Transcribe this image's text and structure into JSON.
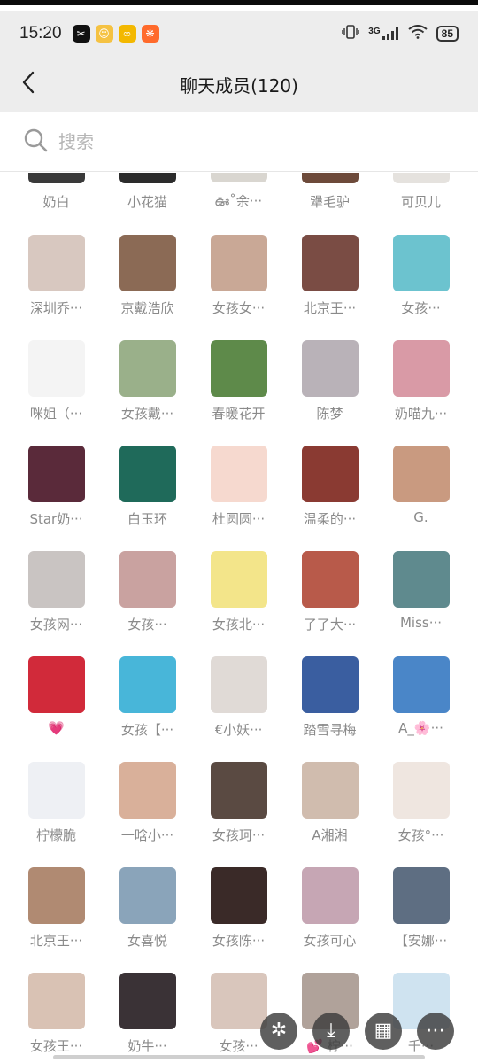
{
  "status_bar": {
    "time": "15:20",
    "network": "3G",
    "battery": "85",
    "notification_icons": [
      {
        "name": "capcut-icon",
        "color": "#111111",
        "glyph": "✂"
      },
      {
        "name": "emoji-icon",
        "color": "#f5c242",
        "glyph": "☺"
      },
      {
        "name": "glasses-icon",
        "color": "#f3b800",
        "glyph": "∞"
      },
      {
        "name": "orange-app-icon",
        "color": "#ff6a2b",
        "glyph": "❋"
      }
    ]
  },
  "nav": {
    "title": "聊天成员(120)"
  },
  "search": {
    "placeholder": "搜索"
  },
  "partial_row": {
    "members": [
      {
        "name": "奶白",
        "color": "#3a3a3a"
      },
      {
        "name": "小花猫",
        "color": "#2c2c2c"
      },
      {
        "name": "ఊ˚余···",
        "color": "#d9d6d0"
      },
      {
        "name": "犟毛驴",
        "color": "#6d4a3a"
      },
      {
        "name": "可贝儿",
        "color": "#e5e2de"
      }
    ]
  },
  "rows": [
    [
      {
        "name": "深圳乔···",
        "color": "#d8c8c0"
      },
      {
        "name": "京戴浩欣",
        "color": "#8b6a55"
      },
      {
        "name": "女孩女···",
        "color": "#c9a896"
      },
      {
        "name": "北京王···",
        "color": "#7a4c44"
      },
      {
        "name": "女孩···",
        "color": "#6cc3cf"
      }
    ],
    [
      {
        "name": "咪姐（···",
        "color": "#f4f4f4"
      },
      {
        "name": "女孩戴···",
        "color": "#9ab08a"
      },
      {
        "name": "春暖花开",
        "color": "#5e8a4a"
      },
      {
        "name": "陈梦",
        "color": "#b9b2b8"
      },
      {
        "name": "奶喵九···",
        "color": "#d99aa6"
      }
    ],
    [
      {
        "name": "Star奶···",
        "color": "#5a2a3a"
      },
      {
        "name": "白玉环",
        "color": "#1f6a5a"
      },
      {
        "name": "杜圆圆···",
        "color": "#f6d9cf"
      },
      {
        "name": "温柔的···",
        "color": "#8a3a32"
      },
      {
        "name": "G.",
        "color": "#c99a80"
      }
    ],
    [
      {
        "name": "女孩网···",
        "color": "#c9c4c2"
      },
      {
        "name": "女孩···",
        "color": "#c9a2a0"
      },
      {
        "name": "女孩北···",
        "color": "#f3e58a"
      },
      {
        "name": "了了大···",
        "color": "#b85a4a"
      },
      {
        "name": "Miss···",
        "color": "#5f8a8e"
      }
    ],
    [
      {
        "name": "💗",
        "color": "#d12a3a"
      },
      {
        "name": "女孩【···",
        "color": "#48b6d9"
      },
      {
        "name": "€小妖···",
        "color": "#e0dad6"
      },
      {
        "name": "踏雪寻梅",
        "color": "#3a5ea0"
      },
      {
        "name": "A_🌸···",
        "color": "#4a86c8"
      }
    ],
    [
      {
        "name": "柠檬脆",
        "color": "#eef0f4"
      },
      {
        "name": "一晗小···",
        "color": "#d9b09a"
      },
      {
        "name": "女孩珂···",
        "color": "#5a4a42"
      },
      {
        "name": "A湘湘",
        "color": "#d0bcae"
      },
      {
        "name": "女孩°···",
        "color": "#efe6e0"
      }
    ],
    [
      {
        "name": "北京王···",
        "color": "#b08a72"
      },
      {
        "name": "女喜悦",
        "color": "#8aa4ba"
      },
      {
        "name": "女孩陈···",
        "color": "#3a2a28"
      },
      {
        "name": "女孩可心",
        "color": "#c6a6b4"
      },
      {
        "name": "【安娜···",
        "color": "#5e6e82"
      }
    ],
    [
      {
        "name": "女孩王···",
        "color": "#d9c2b4"
      },
      {
        "name": "奶牛···",
        "color": "#3a3236"
      },
      {
        "name": "女孩···",
        "color": "#d9c6bc"
      },
      {
        "name": "💕 柠···",
        "color": "#b0a29a"
      },
      {
        "name": "千···",
        "color": "#cfe3f0"
      }
    ]
  ],
  "floating_toolbar": [
    {
      "name": "sparkle-button",
      "glyph": "✲"
    },
    {
      "name": "save-button",
      "glyph": "⤓"
    },
    {
      "name": "grid-button",
      "glyph": "▦"
    },
    {
      "name": "more-button",
      "glyph": "⋯"
    }
  ]
}
